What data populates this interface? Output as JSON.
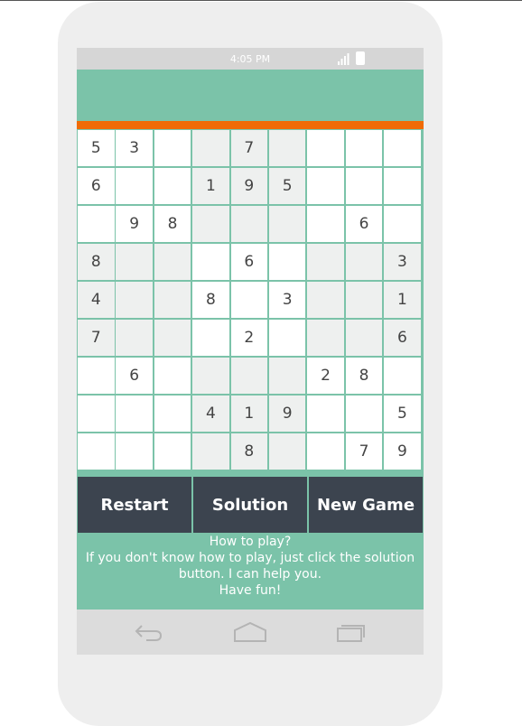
{
  "status_bar": {
    "time": "4:05 PM"
  },
  "board": {
    "rows": [
      [
        "5",
        "3",
        "",
        "",
        "7",
        "",
        "",
        "",
        ""
      ],
      [
        "6",
        "",
        "",
        "1",
        "9",
        "5",
        "",
        "",
        ""
      ],
      [
        "",
        "9",
        "8",
        "",
        "",
        "",
        "",
        "6",
        ""
      ],
      [
        "8",
        "",
        "",
        "",
        "6",
        "",
        "",
        "",
        "3"
      ],
      [
        "4",
        "",
        "",
        "8",
        "",
        "3",
        "",
        "",
        "1"
      ],
      [
        "7",
        "",
        "",
        "",
        "2",
        "",
        "",
        "",
        "6"
      ],
      [
        "",
        "6",
        "",
        "",
        "",
        "",
        "2",
        "8",
        ""
      ],
      [
        "",
        "",
        "",
        "4",
        "1",
        "9",
        "",
        "",
        "5"
      ],
      [
        "",
        "",
        "",
        "",
        "8",
        "",
        "",
        "7",
        "9"
      ]
    ]
  },
  "buttons": {
    "restart": "Restart",
    "solution": "Solution",
    "new_game": "New Game"
  },
  "help": {
    "title": "How to play?",
    "body": "If you don't know how to play, just click the solution button. I can help you.",
    "footer": "Have fun!"
  },
  "colors": {
    "header": "#7bc3a9",
    "accent": "#f06b06",
    "button_bg": "#3c444f"
  },
  "icons": {
    "back": "back-icon",
    "home": "home-icon",
    "recents": "recents-icon"
  }
}
